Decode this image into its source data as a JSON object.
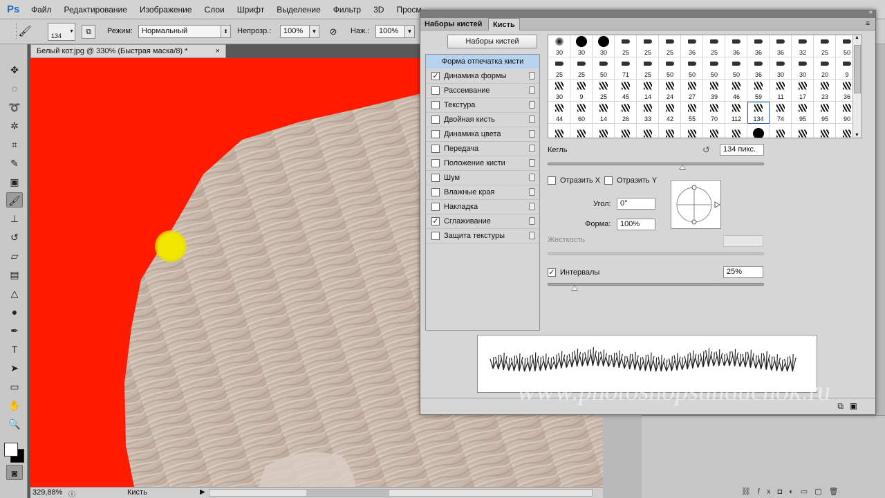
{
  "app": {
    "logo": "Ps"
  },
  "menu": {
    "items": [
      "Файл",
      "Редактирование",
      "Изображение",
      "Слои",
      "Шрифт",
      "Выделение",
      "Фильтр",
      "3D",
      "Просм"
    ]
  },
  "options": {
    "brush_size": "134",
    "mode_label": "Режим:",
    "mode_value": "Нормальный",
    "opacity_label": "Непрозр.:",
    "opacity_value": "100%",
    "flow_label": "Наж.:",
    "flow_value": "100%"
  },
  "document": {
    "tab_title": "Белый кот.jpg @ 330% (Быстрая маска/8) *",
    "close": "×",
    "mask_color": "#ff1a00"
  },
  "status": {
    "zoom": "329,88%",
    "tool_name": "Кисть"
  },
  "panel": {
    "tabs": [
      "Наборы кистей",
      "Кисть"
    ],
    "active_tab": "Кисть",
    "presets_button": "Наборы кистей",
    "list_header": "Форма отпечатка кисти",
    "list": [
      {
        "label": "Динамика формы",
        "checked": true
      },
      {
        "label": "Рассеивание",
        "checked": false
      },
      {
        "label": "Текстура",
        "checked": false
      },
      {
        "label": "Двойная кисть",
        "checked": false
      },
      {
        "label": "Динамика цвета",
        "checked": false
      },
      {
        "label": "Передача",
        "checked": false
      },
      {
        "label": "Положение кисти",
        "checked": false
      },
      {
        "label": "Шум",
        "checked": false
      },
      {
        "label": "Влажные края",
        "checked": false
      },
      {
        "label": "Накладка",
        "checked": false
      },
      {
        "label": "Сглаживание",
        "checked": true
      },
      {
        "label": "Защита текстуры",
        "checked": false
      }
    ],
    "brush_sizes": [
      [
        "30",
        "30",
        "30",
        "25",
        "25",
        "25",
        "36",
        "25",
        "36",
        "36",
        "36",
        "32",
        "25",
        "50"
      ],
      [
        "25",
        "25",
        "50",
        "71",
        "25",
        "50",
        "50",
        "50",
        "50",
        "36",
        "30",
        "30",
        "20",
        "9"
      ],
      [
        "30",
        "9",
        "25",
        "45",
        "14",
        "24",
        "27",
        "39",
        "46",
        "59",
        "11",
        "17",
        "23",
        "36"
      ],
      [
        "44",
        "60",
        "14",
        "26",
        "33",
        "42",
        "55",
        "70",
        "112",
        "134",
        "74",
        "95",
        "95",
        "90"
      ],
      [
        "",
        "",
        "",
        "",
        "",
        "",
        "",
        "",
        "",
        "",
        "",
        "",
        "",
        ""
      ]
    ],
    "selected_brush": "134",
    "size_label": "Кегль",
    "size_value": "134 пикс.",
    "flip_x": "Отразить X",
    "flip_y": "Отразить Y",
    "angle_label": "Угол:",
    "angle_value": "0°",
    "roundness_label": "Форма:",
    "roundness_value": "100%",
    "hardness_label": "Жесткость",
    "spacing_label": "Интервалы",
    "spacing_checked": true,
    "spacing_value": "25%",
    "size_slider_level": 0.62,
    "spacing_slider_level": 0.12
  },
  "watermark": "www.photoshopsunduchok.ru"
}
